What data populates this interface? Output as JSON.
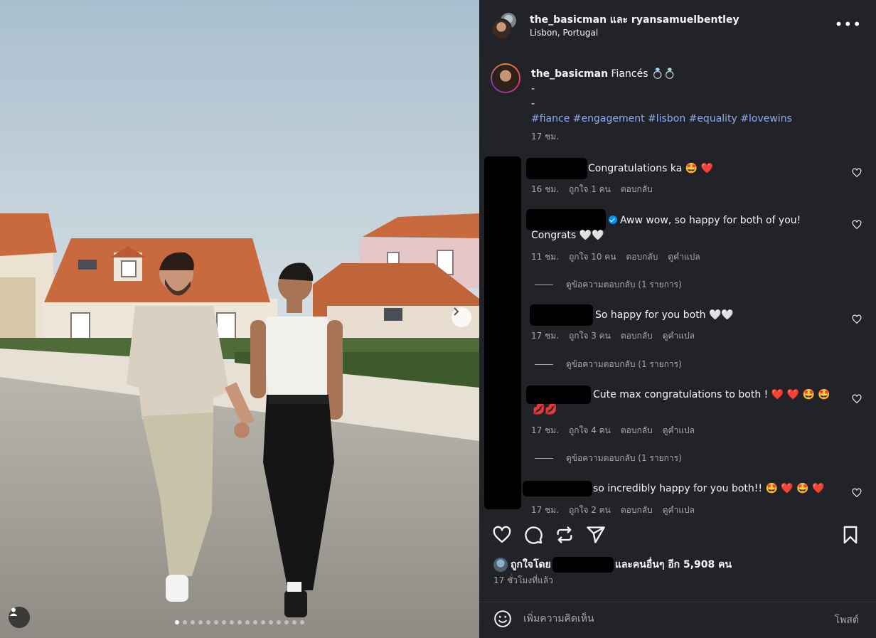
{
  "header": {
    "names": "the_basicman และ ryansamuelbentley",
    "location": "Lisbon, Portugal",
    "more_label": "•••"
  },
  "caption": {
    "username": "the_basicman",
    "text": " Fiancés 💍💍",
    "line2": "-",
    "line3": "-",
    "hashtags": "#fiance #engagement #lisbon #equality #lovewins",
    "time": "17 ชม."
  },
  "comments": [
    {
      "text": "Congratulations ka 🤩 ❤️",
      "time": "16 ชม.",
      "likes": "ถูกใจ 1 คน",
      "reply": "ตอบกลับ"
    },
    {
      "text": "Aww wow, so happy for both of you!",
      "text2": "Congrats 🤍🤍",
      "time": "11 ชม.",
      "likes": "ถูกใจ 10 คน",
      "reply": "ตอบกลับ",
      "translate": "ดูคำแปล",
      "view_replies": "ดูข้อความตอบกลับ (1 รายการ)"
    },
    {
      "text": "So happy for you both 🤍🤍",
      "time": "17 ชม.",
      "likes": "ถูกใจ 3 คน",
      "reply": "ตอบกลับ",
      "translate": "ดูคำแปล",
      "view_replies": "ดูข้อความตอบกลับ (1 รายการ)"
    },
    {
      "text": "Cute max congratulations to both ! ❤️ ❤️ 🤩 🤩",
      "text2": "💋💋",
      "time": "17 ชม.",
      "likes": "ถูกใจ 4 คน",
      "reply": "ตอบกลับ",
      "translate": "ดูคำแปล",
      "view_replies": "ดูข้อความตอบกลับ (1 รายการ)"
    },
    {
      "text": "so incredibly happy for you both!! 🤩 ❤️ 🤩 ❤️",
      "time": "17 ชม.",
      "likes": "ถูกใจ 2 คน",
      "reply": "ตอบกลับ",
      "translate": "ดูคำแปล"
    }
  ],
  "likes": {
    "prefix": "ถูกใจโดย",
    "suffix": "และคนอื่นๆ อีก 5,908 คน"
  },
  "post_time": "17 ชั่วโมงที่แล้ว",
  "comment_bar": {
    "placeholder": "เพิ่มความคิดเห็น",
    "post_label": "โพสต์"
  },
  "carousel": {
    "slides": 17,
    "active_index": 0
  }
}
